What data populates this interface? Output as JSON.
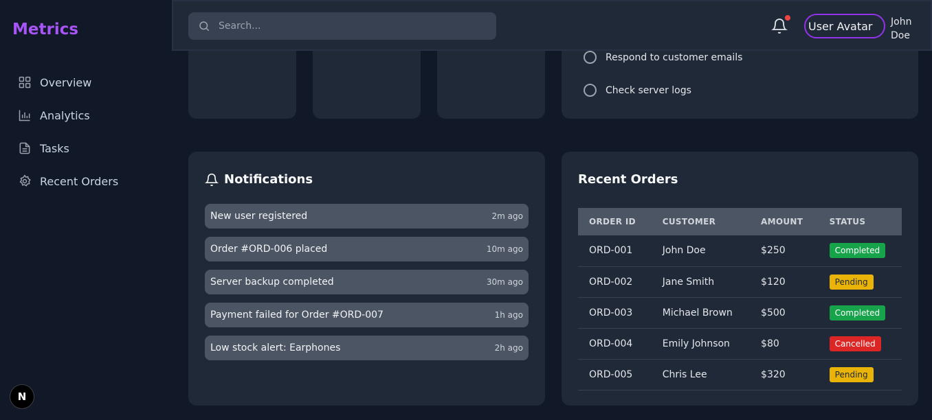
{
  "brand": "Metrics",
  "nav": [
    {
      "label": "Overview",
      "icon": "grid-icon"
    },
    {
      "label": "Analytics",
      "icon": "bar-chart-icon"
    },
    {
      "label": "Tasks",
      "icon": "document-icon"
    },
    {
      "label": "Recent Orders",
      "icon": "gear-icon"
    }
  ],
  "next_badge": "N",
  "header": {
    "search_placeholder": "Search...",
    "avatar_text": "User Avatar",
    "username": "John Doe"
  },
  "tasks": [
    {
      "label": "Respond to customer emails"
    },
    {
      "label": "Check server logs"
    }
  ],
  "notifications": {
    "title": "Notifications",
    "items": [
      {
        "text": "New user registered",
        "time": "2m ago"
      },
      {
        "text": "Order #ORD-006 placed",
        "time": "10m ago"
      },
      {
        "text": "Server backup completed",
        "time": "30m ago"
      },
      {
        "text": "Payment failed for Order #ORD-007",
        "time": "1h ago"
      },
      {
        "text": "Low stock alert: Earphones",
        "time": "2h ago"
      }
    ]
  },
  "orders": {
    "title": "Recent Orders",
    "columns": [
      "ORDER ID",
      "CUSTOMER",
      "AMOUNT",
      "STATUS"
    ],
    "rows": [
      {
        "id": "ORD-001",
        "customer": "John Doe",
        "amount": "$250",
        "status": "Completed"
      },
      {
        "id": "ORD-002",
        "customer": "Jane Smith",
        "amount": "$120",
        "status": "Pending"
      },
      {
        "id": "ORD-003",
        "customer": "Michael Brown",
        "amount": "$500",
        "status": "Completed"
      },
      {
        "id": "ORD-004",
        "customer": "Emily Johnson",
        "amount": "$80",
        "status": "Cancelled"
      },
      {
        "id": "ORD-005",
        "customer": "Chris Lee",
        "amount": "$320",
        "status": "Pending"
      }
    ]
  },
  "colors": {
    "accent": "#a855f7",
    "completed": "#16a34a",
    "pending": "#eab308",
    "cancelled": "#dc2626"
  }
}
